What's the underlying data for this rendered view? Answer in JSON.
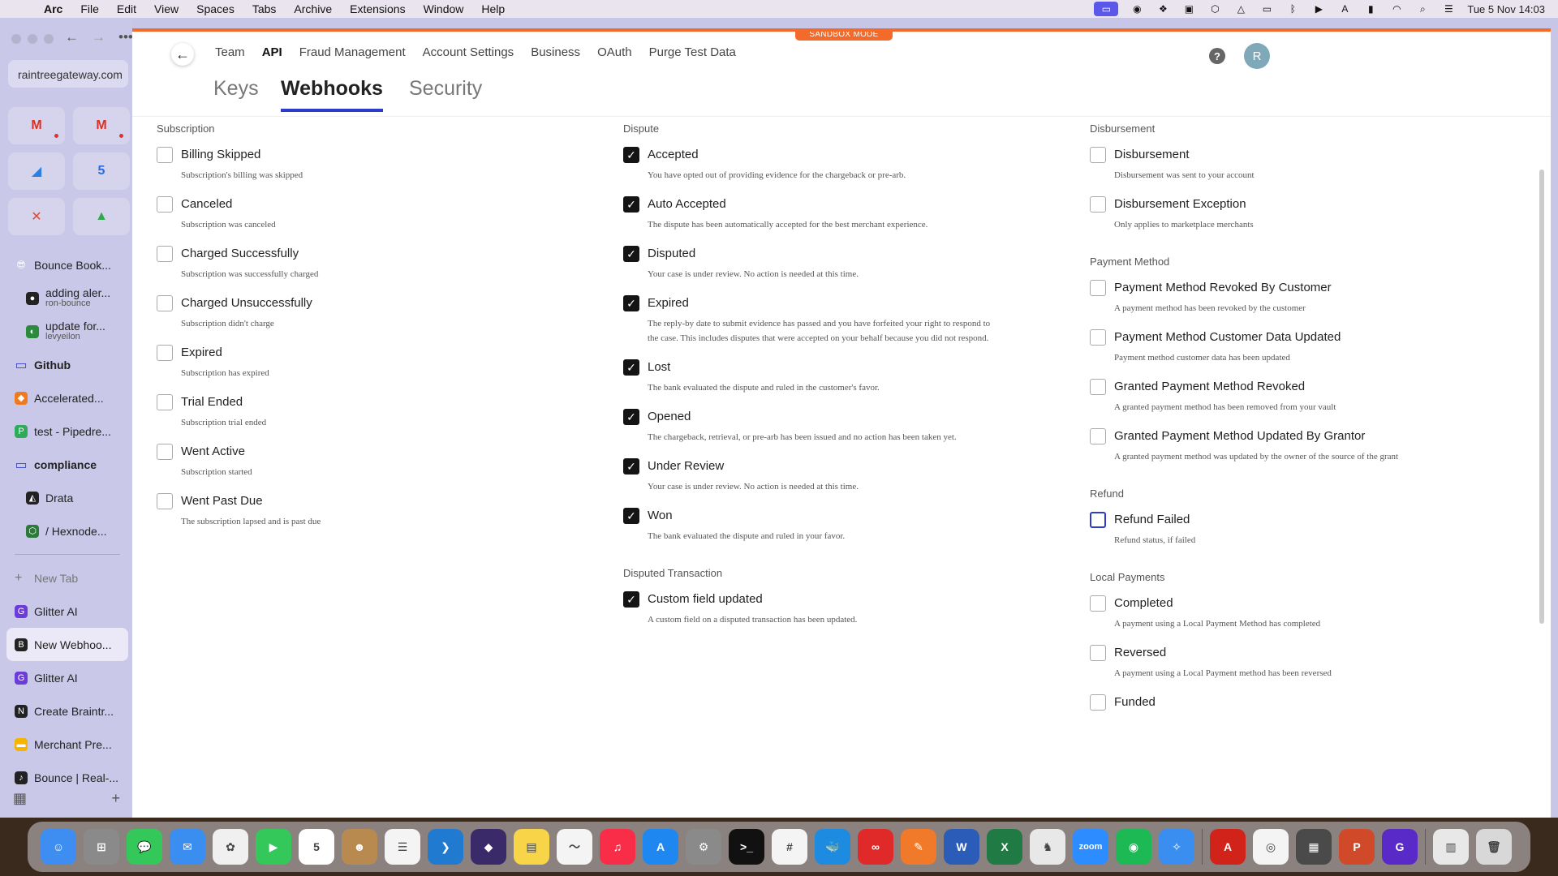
{
  "menubar": {
    "app": "Arc",
    "items": [
      "File",
      "Edit",
      "View",
      "Spaces",
      "Tabs",
      "Archive",
      "Extensions",
      "Window",
      "Help"
    ],
    "clock": "Tue 5 Nov  14:03"
  },
  "sidebar": {
    "url": "raintreegateway.com",
    "favorites": [
      {
        "icon": "gmail-icon",
        "glyph": "M",
        "color": "#d93025",
        "dot": true
      },
      {
        "icon": "gmail-icon",
        "glyph": "M",
        "color": "#d93025",
        "dot": true
      },
      {
        "icon": "rocket-icon",
        "glyph": "◢",
        "color": "#2a7fe0",
        "dot": false
      },
      {
        "icon": "calendar-icon",
        "glyph": "5",
        "color": "#2a6be0",
        "dot": false
      },
      {
        "icon": "x-icon",
        "glyph": "✕",
        "color": "#e04a30",
        "dot": false
      },
      {
        "icon": "drive-icon",
        "glyph": "▲",
        "color": "#2ea84a",
        "dot": false
      }
    ],
    "tabs": [
      {
        "label": "Bounce Book...",
        "icon": "emoji-icon",
        "glyph": "😎",
        "color": "transparent",
        "kind": "tab"
      },
      {
        "label": "adding aler...",
        "sub": "ron-bounce",
        "icon": "github-icon",
        "glyph": "●",
        "color": "#222",
        "kind": "indent"
      },
      {
        "label": "update for...",
        "sub": "levyeilon",
        "icon": "github-pr-icon",
        "glyph": "◐",
        "color": "#2c8a3c",
        "kind": "indent"
      },
      {
        "label": "Github",
        "icon": "folder-icon",
        "glyph": "▭",
        "color": "transparent",
        "kind": "folder"
      },
      {
        "label": "Accelerated...",
        "icon": "box-icon",
        "glyph": "◆",
        "color": "#f07a20",
        "kind": "tab"
      },
      {
        "label": "test - Pipedre...",
        "icon": "pipedream-icon",
        "glyph": "P",
        "color": "#2faa5a",
        "kind": "tab"
      },
      {
        "label": "compliance",
        "icon": "folder-icon",
        "glyph": "▭",
        "color": "transparent",
        "kind": "folder"
      },
      {
        "label": "Drata",
        "icon": "drata-icon",
        "glyph": "◭",
        "color": "#222",
        "kind": "indent"
      },
      {
        "label": "/ Hexnode...",
        "icon": "hexnode-icon",
        "glyph": "⬡",
        "color": "#2c7a3a",
        "kind": "indent"
      }
    ],
    "new_tab": "New Tab",
    "tabs2": [
      {
        "label": "Glitter AI",
        "icon": "glitter-icon",
        "glyph": "G",
        "color": "#6b3cd8",
        "selected": false
      },
      {
        "label": "New Webhoo...",
        "icon": "braintree-icon",
        "glyph": "B",
        "color": "#222",
        "selected": true
      },
      {
        "label": "Glitter AI",
        "icon": "glitter-icon",
        "glyph": "G",
        "color": "#6b3cd8",
        "selected": false
      },
      {
        "label": "Create Braintr...",
        "icon": "notion-icon",
        "glyph": "N",
        "color": "#222",
        "selected": false
      },
      {
        "label": "Merchant Pre...",
        "icon": "slides-icon",
        "glyph": "▬",
        "color": "#f4b400",
        "selected": false
      },
      {
        "label": "Bounce | Real-...",
        "icon": "bounce-icon",
        "glyph": "♪",
        "color": "#222",
        "selected": false
      }
    ]
  },
  "top_nav": {
    "links": [
      "Team",
      "API",
      "Fraud Management",
      "Account Settings",
      "Business",
      "OAuth",
      "Purge Test Data"
    ],
    "active": "API",
    "sandbox": "SANDBOX MODE",
    "help": "?",
    "avatar": "R"
  },
  "subtabs": [
    "Keys",
    "Webhooks",
    "Security"
  ],
  "columns": [
    {
      "sections": [
        {
          "title": "Subscription",
          "hooks": [
            {
              "name": "Billing Skipped",
              "desc": "Subscription's billing was skipped",
              "checked": false
            },
            {
              "name": "Canceled",
              "desc": "Subscription was canceled",
              "checked": false
            },
            {
              "name": "Charged Successfully",
              "desc": "Subscription was successfully charged",
              "checked": false
            },
            {
              "name": "Charged Unsuccessfully",
              "desc": "Subscription didn't charge",
              "checked": false
            },
            {
              "name": "Expired",
              "desc": "Subscription has expired",
              "checked": false
            },
            {
              "name": "Trial Ended",
              "desc": "Subscription trial ended",
              "checked": false
            },
            {
              "name": "Went Active",
              "desc": "Subscription started",
              "checked": false
            },
            {
              "name": "Went Past Due",
              "desc": "The subscription lapsed and is past due",
              "checked": false
            }
          ]
        }
      ]
    },
    {
      "sections": [
        {
          "title": "Dispute",
          "hooks": [
            {
              "name": "Accepted",
              "desc": "You have opted out of providing evidence for the chargeback or pre-arb.",
              "checked": true
            },
            {
              "name": "Auto Accepted",
              "desc": "The dispute has been automatically accepted for the best merchant experience.",
              "checked": true
            },
            {
              "name": "Disputed",
              "desc": "Your case is under review. No action is needed at this time.",
              "checked": true
            },
            {
              "name": "Expired",
              "desc": "The reply-by date to submit evidence has passed and you have forfeited your right to respond to the case. This includes disputes that were accepted on your behalf because you did not respond.",
              "checked": true
            },
            {
              "name": "Lost",
              "desc": "The bank evaluated the dispute and ruled in the customer's favor.",
              "checked": true
            },
            {
              "name": "Opened",
              "desc": "The chargeback, retrieval, or pre-arb has been issued and no action has been taken yet.",
              "checked": true
            },
            {
              "name": "Under Review",
              "desc": "Your case is under review. No action is needed at this time.",
              "checked": true
            },
            {
              "name": "Won",
              "desc": "The bank evaluated the dispute and ruled in your favor.",
              "checked": true
            }
          ]
        },
        {
          "title": "Disputed Transaction",
          "hooks": [
            {
              "name": "Custom field updated",
              "desc": "A custom field on a disputed transaction has been updated.",
              "checked": true
            }
          ]
        }
      ]
    },
    {
      "sections": [
        {
          "title": "Disbursement",
          "hooks": [
            {
              "name": "Disbursement",
              "desc": "Disbursement was sent to your account",
              "checked": false
            },
            {
              "name": "Disbursement Exception",
              "desc": "Only applies to marketplace merchants",
              "checked": false
            }
          ]
        },
        {
          "title": "Payment Method",
          "hooks": [
            {
              "name": "Payment Method Revoked By Customer",
              "desc": "A payment method has been revoked by the customer",
              "checked": false
            },
            {
              "name": "Payment Method Customer Data Updated",
              "desc": "Payment method customer data has been updated",
              "checked": false
            },
            {
              "name": "Granted Payment Method Revoked",
              "desc": "A granted payment method has been removed from your vault",
              "checked": false
            },
            {
              "name": "Granted Payment Method Updated By Grantor",
              "desc": "A granted payment method was updated by the owner of the source of the grant",
              "checked": false
            }
          ]
        },
        {
          "title": "Refund",
          "hooks": [
            {
              "name": "Refund Failed",
              "desc": "Refund status, if failed",
              "checked": false,
              "focused": true
            }
          ]
        },
        {
          "title": "Local Payments",
          "hooks": [
            {
              "name": "Completed",
              "desc": "A payment using a Local Payment Method has completed",
              "checked": false
            },
            {
              "name": "Reversed",
              "desc": "A payment using a Local Payment method has been reversed",
              "checked": false
            },
            {
              "name": "Funded",
              "desc": "",
              "checked": false
            }
          ]
        }
      ]
    }
  ],
  "dock": [
    {
      "name": "finder-icon",
      "glyph": "☺",
      "color": "#3d8ef0"
    },
    {
      "name": "launchpad-icon",
      "glyph": "⊞",
      "color": "#8a8a8a"
    },
    {
      "name": "messages-icon",
      "glyph": "💬",
      "color": "#34c759"
    },
    {
      "name": "mail-icon",
      "glyph": "✉",
      "color": "#3a8ef0"
    },
    {
      "name": "photos-icon",
      "glyph": "✿",
      "color": "#f0f0f0"
    },
    {
      "name": "facetime-icon",
      "glyph": "▶",
      "color": "#34c759"
    },
    {
      "name": "calendar-icon",
      "glyph": "5",
      "color": "#ffffff"
    },
    {
      "name": "contacts-icon",
      "glyph": "☻",
      "color": "#b88a50"
    },
    {
      "name": "reminders-icon",
      "glyph": "☰",
      "color": "#f4f4f4"
    },
    {
      "name": "vscode-icon",
      "glyph": "❯",
      "color": "#1f7ad0"
    },
    {
      "name": "affinity-icon",
      "glyph": "◆",
      "color": "#3b2a6a"
    },
    {
      "name": "notes-icon",
      "glyph": "▤",
      "color": "#f8d448"
    },
    {
      "name": "freeform-icon",
      "glyph": "〜",
      "color": "#f4f4f4"
    },
    {
      "name": "music-icon",
      "glyph": "♫",
      "color": "#fa2d48"
    },
    {
      "name": "appstore-icon",
      "glyph": "A",
      "color": "#1e88f0"
    },
    {
      "name": "settings-icon",
      "glyph": "⚙",
      "color": "#8a8a8a"
    },
    {
      "name": "terminal-icon",
      "glyph": ">_",
      "color": "#111111"
    },
    {
      "name": "slack-icon",
      "glyph": "#",
      "color": "#f4f4f4"
    },
    {
      "name": "docker-icon",
      "glyph": "🐳",
      "color": "#1d8ce0"
    },
    {
      "name": "creative-cloud-icon",
      "glyph": "∞",
      "color": "#e02a2a"
    },
    {
      "name": "sketch-icon",
      "glyph": "✎",
      "color": "#f07a2a"
    },
    {
      "name": "word-icon",
      "glyph": "W",
      "color": "#2b5cb8"
    },
    {
      "name": "excel-icon",
      "glyph": "X",
      "color": "#1f7a44"
    },
    {
      "name": "bartender-icon",
      "glyph": "♞",
      "color": "#e8e8e8"
    },
    {
      "name": "zoom-icon",
      "glyph": "zoom",
      "color": "#2d8cff"
    },
    {
      "name": "spotify-icon",
      "glyph": "◉",
      "color": "#1db954"
    },
    {
      "name": "safari-icon",
      "glyph": "✧",
      "color": "#3a8ef0"
    },
    {
      "name": "acrobat-icon",
      "glyph": "A",
      "color": "#d2231a"
    },
    {
      "name": "chrome-icon",
      "glyph": "◎",
      "color": "#f4f4f4"
    },
    {
      "name": "calculator-icon",
      "glyph": "▦",
      "color": "#4a4a4a"
    },
    {
      "name": "powerpoint-icon",
      "glyph": "P",
      "color": "#d04a2a"
    },
    {
      "name": "glitter-icon",
      "glyph": "G",
      "color": "#5a2ac8"
    },
    {
      "name": "preview-icon",
      "glyph": "▥",
      "color": "#e8e8e8"
    },
    {
      "name": "trash-icon",
      "glyph": "🗑",
      "color": "#d8d8d8"
    }
  ]
}
